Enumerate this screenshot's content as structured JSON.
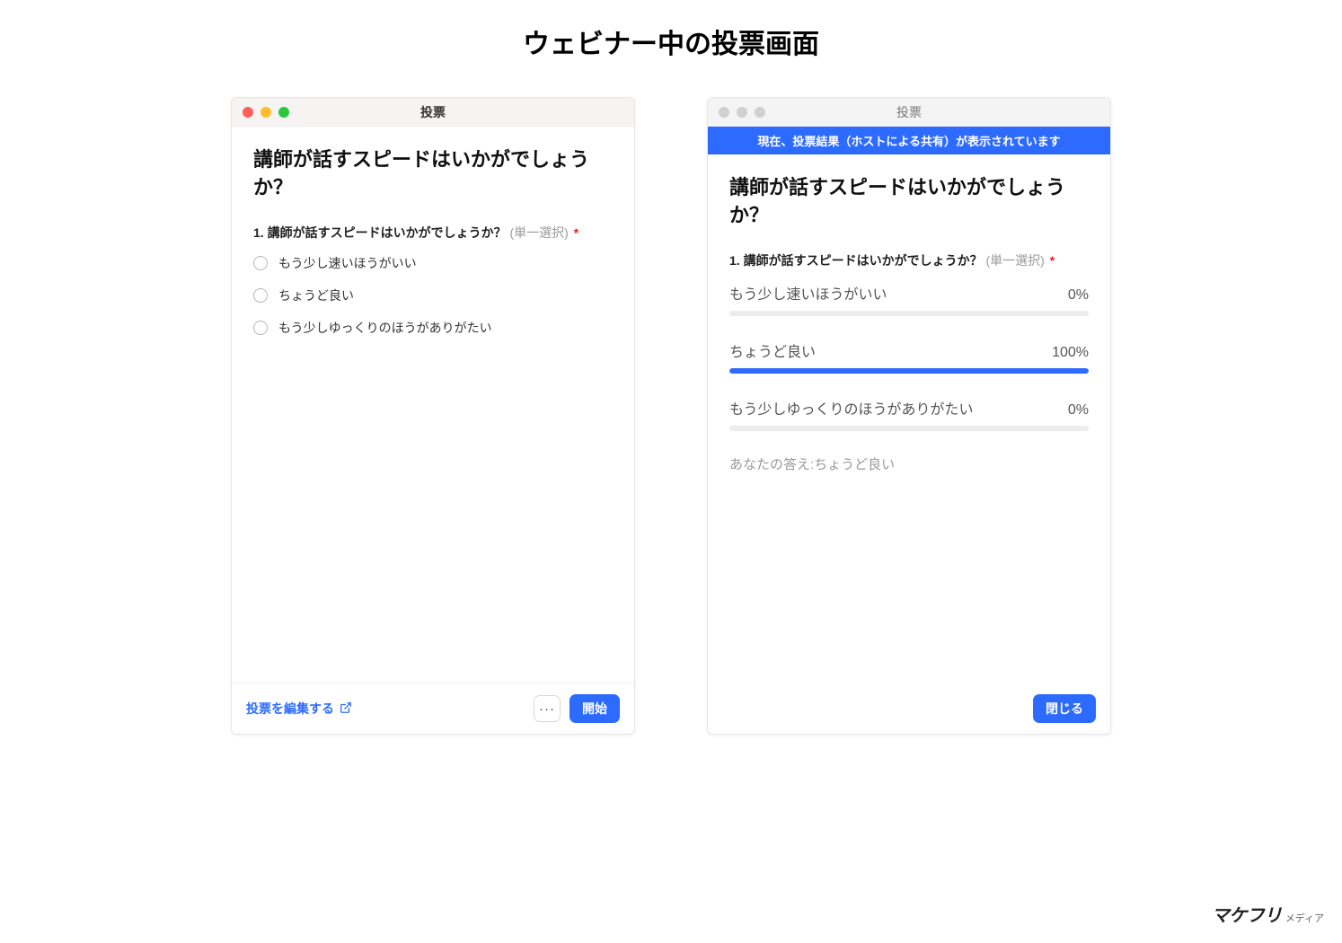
{
  "page": {
    "title": "ウェビナー中の投票画面"
  },
  "leftWindow": {
    "titlebar": "投票",
    "questionTitle": "講師が話すスピードはいかがでしょうか？",
    "questionNumber": "1.",
    "questionText": "講師が話すスピードはいかがでしょうか？",
    "questionType": "(単一選択)",
    "requiredMark": "*",
    "options": [
      {
        "label": "もう少し速いほうがいい"
      },
      {
        "label": "ちょうど良い"
      },
      {
        "label": "もう少しゆっくりのほうがありがたい"
      }
    ],
    "editLink": "投票を編集する",
    "moreLabel": "···",
    "startBtn": "開始"
  },
  "rightWindow": {
    "titlebar": "投票",
    "banner": "現在、投票結果（ホストによる共有）が表示されています",
    "questionTitle": "講師が話すスピードはいかがでしょうか？",
    "questionNumber": "1.",
    "questionText": "講師が話すスピードはいかがでしょうか？",
    "questionType": "(単一選択)",
    "requiredMark": "*",
    "results": [
      {
        "label": "もう少し速いほうがいい",
        "percentLabel": "0%",
        "percent": 0
      },
      {
        "label": "ちょうど良い",
        "percentLabel": "100%",
        "percent": 100
      },
      {
        "label": "もう少しゆっくりのほうがありがたい",
        "percentLabel": "0%",
        "percent": 0
      }
    ],
    "yourAnswer": "あなたの答え:ちょうど良い",
    "closeBtn": "閉じる"
  },
  "brand": {
    "main": "マケフリ",
    "sub": "メディア"
  },
  "colors": {
    "accent": "#2d6bff"
  }
}
